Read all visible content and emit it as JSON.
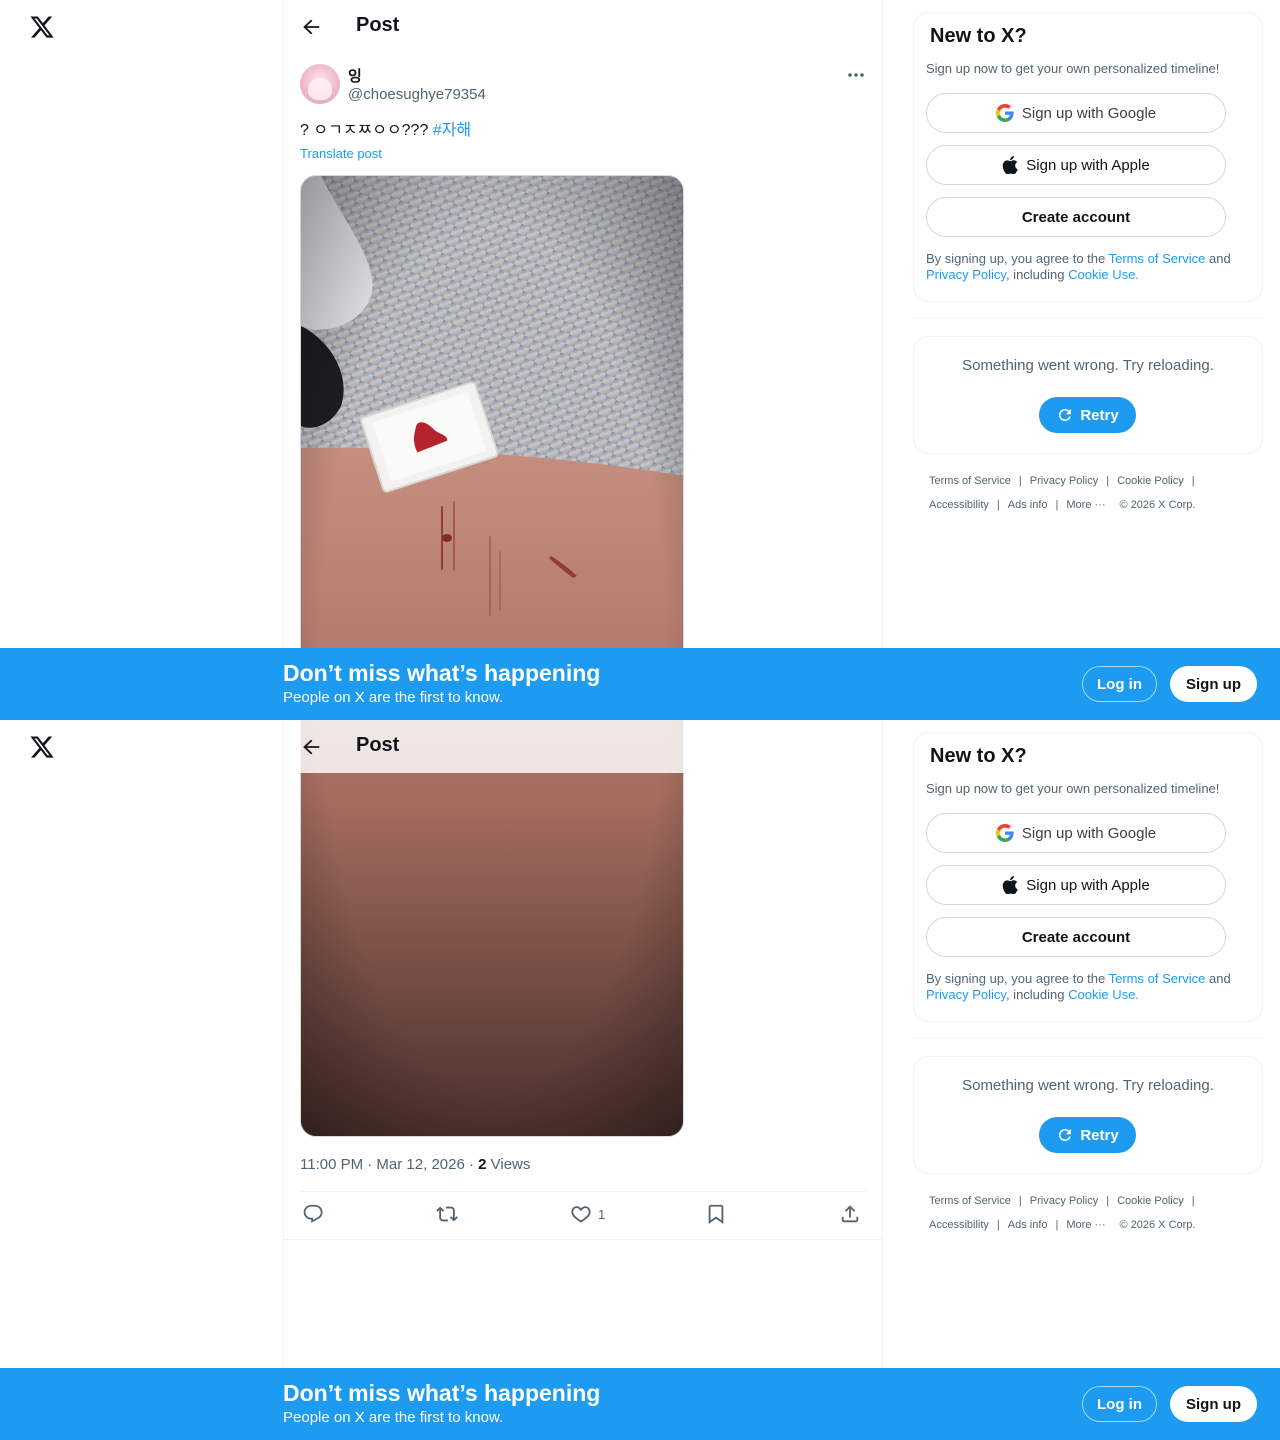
{
  "header": {
    "title": "Post"
  },
  "post": {
    "display_name": "잉",
    "handle": "@choesughye79354",
    "text": "? ㅇㄱㅈㅉㅇㅇ??? ",
    "hashtag": "#자해",
    "translate_label": "Translate post",
    "time": "11:00 PM · Mar 12, 2026 · ",
    "views_count": "2",
    "views_label": " Views",
    "like_count": "1"
  },
  "signup_card": {
    "title": "New to X?",
    "subtitle": "Sign up now to get your own personalized timeline!",
    "google_label": "Sign up with Google",
    "apple_label": "Sign up with Apple",
    "create_label": "Create account",
    "terms_prefix": "By signing up, you agree to the ",
    "terms_link": "Terms of Service",
    "terms_and": " and ",
    "privacy_link": "Privacy Policy",
    "terms_including": ", including ",
    "cookie_link": "Cookie Use."
  },
  "error_card": {
    "message": "Something went wrong. Try reloading.",
    "retry_label": "Retry"
  },
  "footer": {
    "terms": "Terms of Service",
    "privacy": "Privacy Policy",
    "cookie": "Cookie Policy",
    "accessibility": "Accessibility",
    "ads": "Ads info",
    "more": "More ···",
    "copyright": "© 2026 X Corp."
  },
  "banner": {
    "title": "Don’t miss what’s happening",
    "subtitle": "People on X are the first to know.",
    "login_label": "Log in",
    "signup_label": "Sign up"
  },
  "colors": {
    "accent": "#1d9bf0",
    "text_primary": "#0f1419",
    "text_secondary": "#536471",
    "border": "#eff3f4"
  },
  "icons": [
    "x-logo-icon",
    "back-arrow-icon",
    "more-icon",
    "google-icon",
    "apple-icon",
    "retry-icon",
    "reply-icon",
    "repost-icon",
    "like-icon",
    "bookmark-icon",
    "share-icon"
  ]
}
